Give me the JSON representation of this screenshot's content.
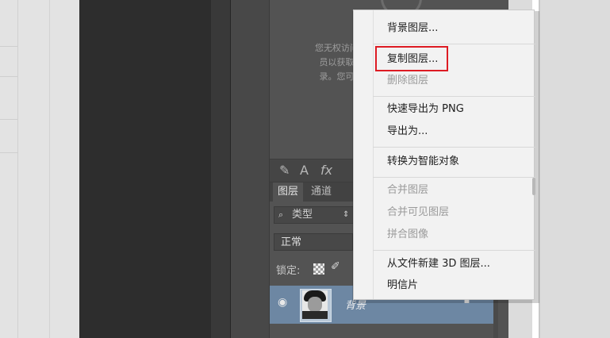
{
  "libraries": {
    "message_lines": [
      "您无权访问此",
      "员以获取访",
      "录。您可以"
    ]
  },
  "style_toolbar": {
    "icons": [
      "brush-style-icon",
      "text-icon",
      "fx-icon"
    ],
    "text_icon_glyph": "A",
    "fx_glyph": "fx"
  },
  "layers_panel": {
    "tabs": [
      "图层",
      "通道"
    ],
    "filter_label": "类型",
    "blend_mode": "正常",
    "lock_label": "锁定:",
    "layer": {
      "name": "背景",
      "visible": true,
      "locked": true
    }
  },
  "context_menu": {
    "groups": [
      [
        {
          "label": "背景图层...",
          "enabled": true
        }
      ],
      [
        {
          "label": "复制图层...",
          "enabled": true,
          "highlighted": true
        },
        {
          "label": "删除图层",
          "enabled": false
        }
      ],
      [
        {
          "label": "快速导出为 PNG",
          "enabled": true
        },
        {
          "label": "导出为...",
          "enabled": true
        }
      ],
      [
        {
          "label": "转换为智能对象",
          "enabled": true
        }
      ],
      [
        {
          "label": "合并图层",
          "enabled": false
        },
        {
          "label": "合并可见图层",
          "enabled": false
        },
        {
          "label": "拼合图像",
          "enabled": false
        }
      ],
      [
        {
          "label": "从文件新建 3D 图层...",
          "enabled": true
        },
        {
          "label": "明信片",
          "enabled": true
        }
      ]
    ],
    "highlight_color": "#dd1b23"
  },
  "colors": {
    "panel_bg": "#535353",
    "selected_layer": "#6d87a3",
    "menu_bg": "#f2f2f2"
  }
}
